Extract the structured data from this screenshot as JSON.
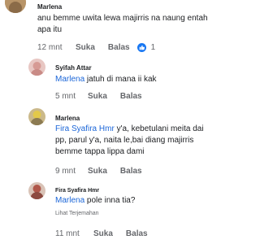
{
  "comments": [
    {
      "author": "Marlena",
      "text": "anu bemme uwita lewa majirris na naung entah apa itu",
      "time": "12 mnt",
      "like_label": "Suka",
      "reply_label": "Balas",
      "reaction_count": "1"
    },
    {
      "author": "Syifah Attar",
      "mention": "Marlena",
      "text": " jatuh di mana ii kak",
      "time": "5 mnt",
      "like_label": "Suka",
      "reply_label": "Balas"
    },
    {
      "author": "Marlena",
      "mention": "Fira Syafira Hmr",
      "text_line1": " y'a, kebetulani meita dai",
      "text_line2": "pp, parul y'a, naita le,bai diang majirris",
      "text_line3": "bemme tappa lippa dami",
      "time": "9 mnt",
      "like_label": "Suka",
      "reply_label": "Balas"
    },
    {
      "author": "Fira Syafira Hmr",
      "mention": "Marlena",
      "text": " pole inna tia?",
      "translation_label": "Lihat Terjemahan",
      "time": "11 mnt",
      "like_label": "Suka",
      "reply_label": "Balas"
    }
  ],
  "colors": {
    "mention": "#1b66d8",
    "muted": "#65676b",
    "like": "#1877f2"
  },
  "icons": [
    "thumbs-up-icon"
  ]
}
